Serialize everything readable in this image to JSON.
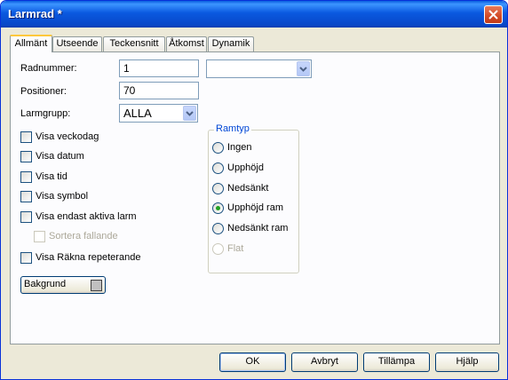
{
  "window": {
    "title": "Larmrad *"
  },
  "tabs": [
    "Allmänt",
    "Utseende",
    "Teckensnitt",
    "Åtkomst",
    "Dynamik"
  ],
  "form": {
    "radnummer_label": "Radnummer:",
    "radnummer_value": "1",
    "radnummer_select_value": "",
    "positioner_label": "Positioner:",
    "positioner_value": "70",
    "larmgrupp_label": "Larmgrupp:",
    "larmgrupp_value": "ALLA"
  },
  "checkboxes": [
    {
      "label": "Visa veckodag",
      "checked": false,
      "enabled": true
    },
    {
      "label": "Visa datum",
      "checked": false,
      "enabled": true
    },
    {
      "label": "Visa tid",
      "checked": false,
      "enabled": true
    },
    {
      "label": "Visa symbol",
      "checked": false,
      "enabled": true
    },
    {
      "label": "Visa endast aktiva larm",
      "checked": false,
      "enabled": true
    },
    {
      "label": "Sortera fallande",
      "checked": false,
      "enabled": false
    },
    {
      "label": "Visa Räkna repeterande",
      "checked": false,
      "enabled": true
    }
  ],
  "ramtyp": {
    "title": "Ramtyp",
    "options": [
      {
        "label": "Ingen",
        "selected": false,
        "enabled": true
      },
      {
        "label": "Upphöjd",
        "selected": false,
        "enabled": true
      },
      {
        "label": "Nedsänkt",
        "selected": false,
        "enabled": true
      },
      {
        "label": "Upphöjd ram",
        "selected": true,
        "enabled": true
      },
      {
        "label": "Nedsänkt ram",
        "selected": false,
        "enabled": true
      },
      {
        "label": "Flat",
        "selected": false,
        "enabled": false
      }
    ]
  },
  "bakgrund": {
    "label": "Bakgrund",
    "color": "#c0c0c0"
  },
  "buttons": {
    "ok": "OK",
    "cancel": "Avbryt",
    "apply": "Tillämpa",
    "help": "Hjälp"
  }
}
